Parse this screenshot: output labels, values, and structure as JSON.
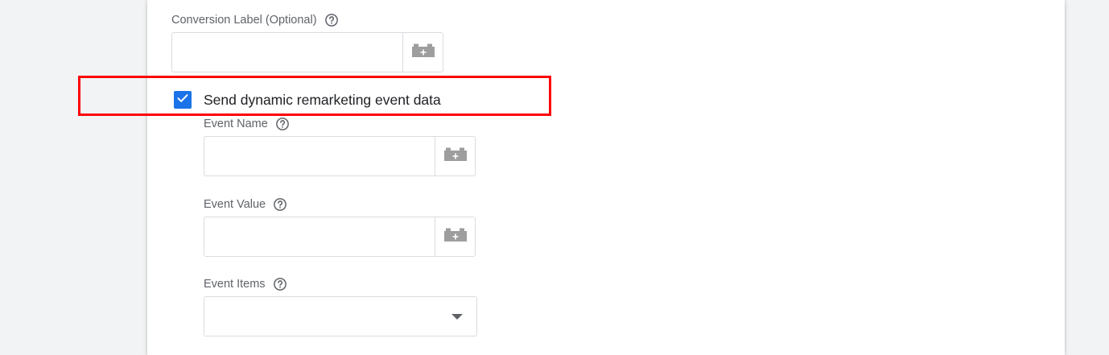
{
  "fields": {
    "conversion_label": {
      "label": "Conversion Label (Optional)",
      "value": "",
      "help_icon": "help-circle-icon",
      "variable_icon": "variable-brick-plus-icon"
    },
    "event_name": {
      "label": "Event Name",
      "value": "",
      "help_icon": "help-circle-icon",
      "variable_icon": "variable-brick-plus-icon"
    },
    "event_value": {
      "label": "Event Value",
      "value": "",
      "help_icon": "help-circle-icon",
      "variable_icon": "variable-brick-plus-icon"
    },
    "event_items": {
      "label": "Event Items",
      "selected": "",
      "help_icon": "help-circle-icon",
      "caret_icon": "caret-down-icon"
    }
  },
  "dynamic_remarketing": {
    "label": "Send dynamic remarketing event data",
    "checked": true,
    "check_icon": "checkmark-icon"
  },
  "colors": {
    "checkbox": "#1a73e8",
    "highlight": "#ff0000",
    "label_text": "#5f6368",
    "body_text": "#202124",
    "border": "#dadce0",
    "icon_gray": "#9e9e9e",
    "background": "#f1f3f4"
  }
}
